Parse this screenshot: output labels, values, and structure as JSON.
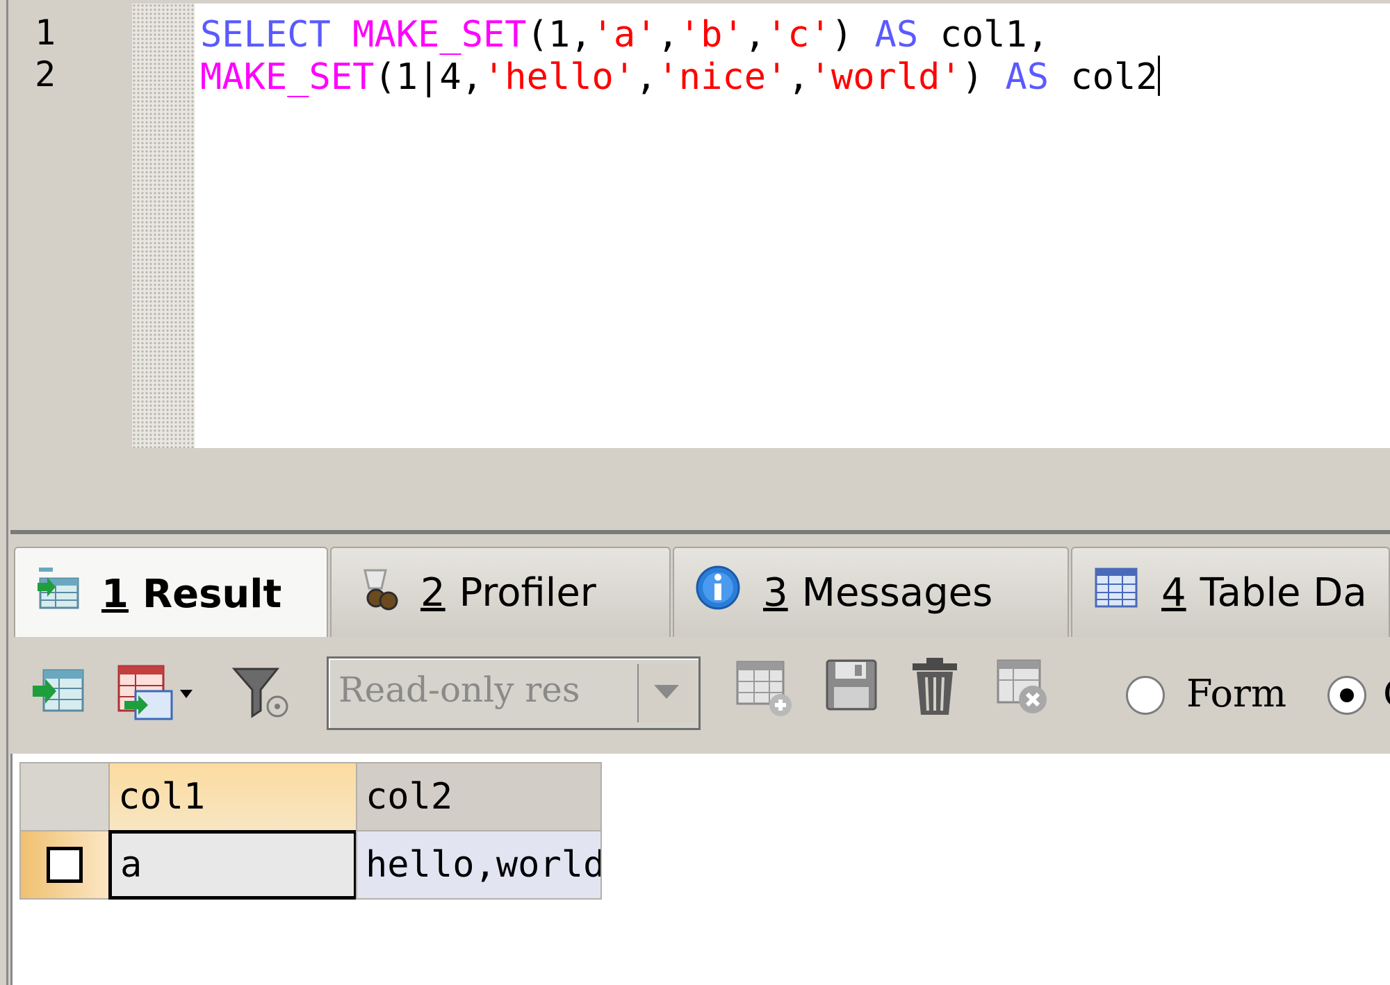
{
  "editor": {
    "line_numbers": [
      "1",
      "2"
    ],
    "lines": [
      [
        {
          "text": "SELECT",
          "color": "#5a5aff"
        },
        {
          "text": " ",
          "color": "#000000"
        },
        {
          "text": "MAKE_SET",
          "color": "#ff00ff"
        },
        {
          "text": "(1,",
          "color": "#000000"
        },
        {
          "text": "'a'",
          "color": "#ff0000"
        },
        {
          "text": ",",
          "color": "#000000"
        },
        {
          "text": "'b'",
          "color": "#ff0000"
        },
        {
          "text": ",",
          "color": "#000000"
        },
        {
          "text": "'c'",
          "color": "#ff0000"
        },
        {
          "text": ") ",
          "color": "#000000"
        },
        {
          "text": "AS",
          "color": "#5a5aff"
        },
        {
          "text": " col1,",
          "color": "#000000"
        }
      ],
      [
        {
          "text": "MAKE_SET",
          "color": "#ff00ff"
        },
        {
          "text": "(1|4,",
          "color": "#000000"
        },
        {
          "text": "'hello'",
          "color": "#ff0000"
        },
        {
          "text": ",",
          "color": "#000000"
        },
        {
          "text": "'nice'",
          "color": "#ff0000"
        },
        {
          "text": ",",
          "color": "#000000"
        },
        {
          "text": "'world'",
          "color": "#ff0000"
        },
        {
          "text": ") ",
          "color": "#000000"
        },
        {
          "text": "AS",
          "color": "#5a5aff"
        },
        {
          "text": " col2",
          "color": "#000000"
        }
      ]
    ]
  },
  "tabs": [
    {
      "num": "1",
      "label": "Result",
      "icon": "result-grid-icon",
      "active": true
    },
    {
      "num": "2",
      "label": "Profiler",
      "icon": "profiler-icon",
      "active": false
    },
    {
      "num": "3",
      "label": "Messages",
      "icon": "info-icon",
      "active": false
    },
    {
      "num": "4",
      "label": "Table Da",
      "icon": "table-data-icon",
      "active": false
    }
  ],
  "toolbar": {
    "readonly_select_value": "Read-only res",
    "form_label": "Form",
    "second_radio_label": "G"
  },
  "grid": {
    "columns": [
      "col1",
      "col2"
    ],
    "rows": [
      [
        "a",
        "hello,world"
      ]
    ]
  }
}
